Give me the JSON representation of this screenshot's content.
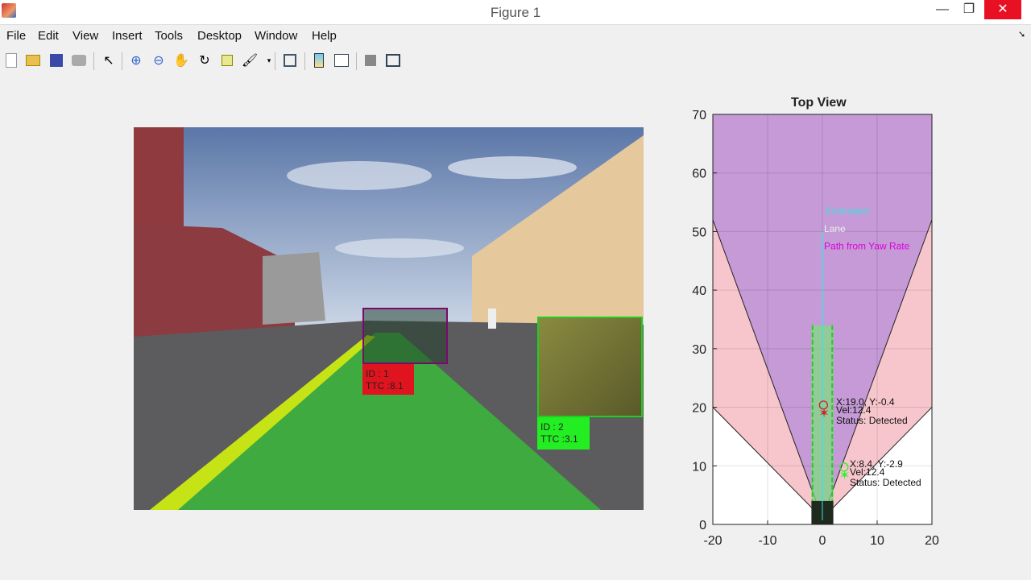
{
  "window": {
    "title": "Figure 1",
    "minimize": "—",
    "maximize": "❐",
    "close": "✕"
  },
  "menu": [
    "File",
    "Edit",
    "View",
    "Insert",
    "Tools",
    "Desktop",
    "Window",
    "Help"
  ],
  "toolbar_icons": [
    "new-figure-icon",
    "open-file-icon",
    "save-icon",
    "print-icon",
    "pointer-icon",
    "zoom-in-icon",
    "zoom-out-icon",
    "pan-icon",
    "rotate-icon",
    "data-cursor-icon",
    "brush-icon",
    "link-plot-icon",
    "colorbar-icon",
    "legend-icon",
    "hide-plot-tools-icon",
    "show-plot-tools-icon"
  ],
  "camera": {
    "detections": [
      {
        "id": "ID : 1",
        "ttc": "TTC :8.1",
        "color": "#e0141e"
      },
      {
        "id": "ID : 2",
        "ttc": "TTC :3.1",
        "color": "#22ee22"
      }
    ]
  },
  "chart_data": {
    "type": "scatter",
    "title": "Top View",
    "xlim": [
      -20,
      20
    ],
    "ylim": [
      0,
      70
    ],
    "xticks": [
      "-20",
      "-10",
      "0",
      "10",
      "20"
    ],
    "yticks": [
      "0",
      "10",
      "20",
      "30",
      "40",
      "50",
      "60",
      "70"
    ],
    "grid": true,
    "legend": [
      {
        "label": "Estimated",
        "color": "#4dd"
      },
      {
        "label": "Lane",
        "color": "#eee"
      },
      {
        "label": "Path from Yaw Rate",
        "color": "#d0d"
      }
    ],
    "coverage": [
      {
        "name": "wide",
        "color": "#f7c6cc",
        "edge_at_x20_y": 20
      },
      {
        "name": "narrow",
        "color": "#c59ad6",
        "edge_at_x20_y": 52
      }
    ],
    "objects": [
      {
        "x": 19.0,
        "y": -0.4,
        "vel": 12.4,
        "label1": "X:19.0, Y:-0.4",
        "label2": "Vel:12.4",
        "label3": "Status: Detected",
        "color": "#c22"
      },
      {
        "x": 8.4,
        "y": -2.9,
        "vel": 12.4,
        "label1": "X:8.4, Y:-2.9",
        "label2": "Vel:12.4",
        "label3": "Status: Detected",
        "color": "#3e3"
      }
    ]
  }
}
